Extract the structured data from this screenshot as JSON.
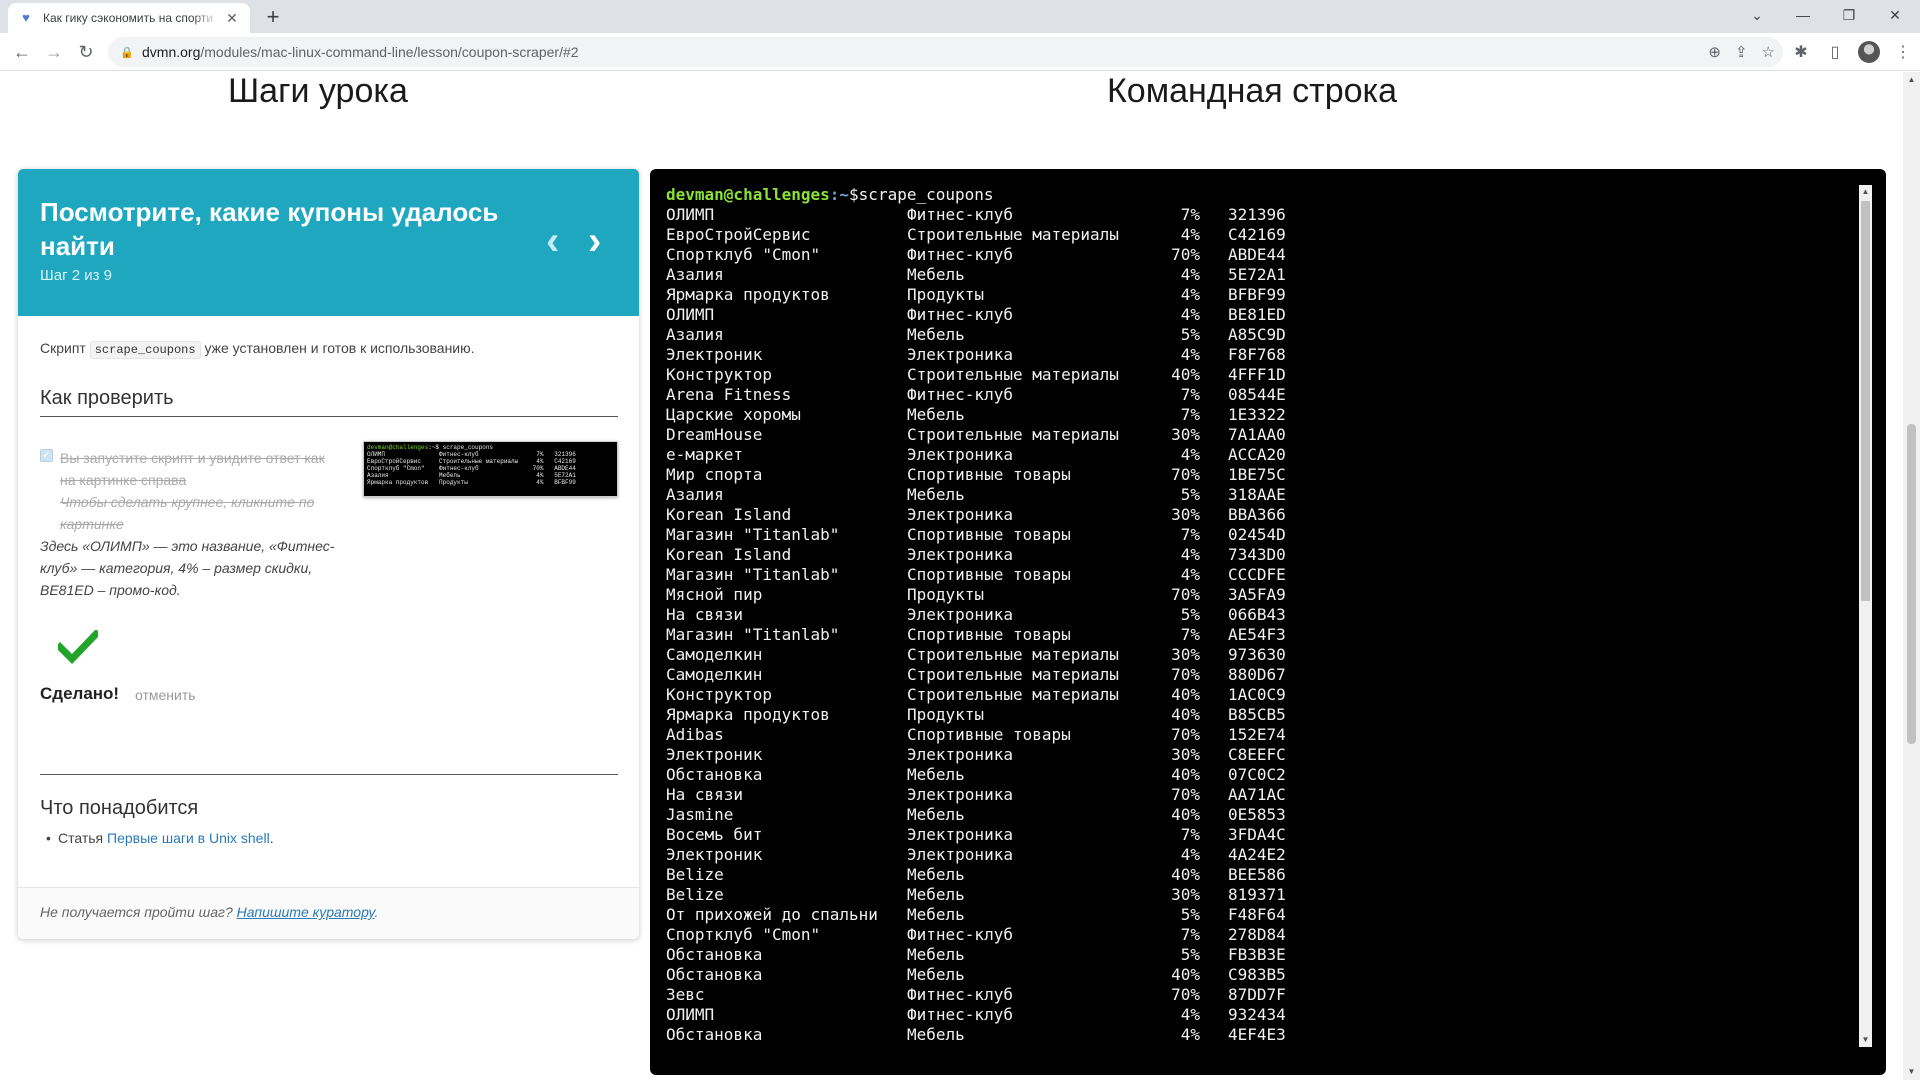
{
  "browser": {
    "tab_title": "Как гику сэкономить на спорти",
    "url_host": "dvmn.org",
    "url_path": "/modules/mac-linux-command-line/lesson/coupon-scraper/#2"
  },
  "headings": {
    "steps": "Шаги урока",
    "command_line": "Командная строка"
  },
  "step": {
    "title": "Посмотрите, какие купоны удалось найти",
    "subtitle": "Шаг 2 из 9",
    "intro_before": "Скрипт",
    "intro_code": "scrape_coupons",
    "intro_after": "уже установлен и готов к использованию.",
    "check_heading": "Как проверить",
    "check_text": "Вы запустите скрипт и увидите ответ как на картинке справа",
    "check_hint": "Чтобы сделать крупнее, кликните по картинке",
    "checked": true,
    "note": "Здесь «ОЛИМП» — это название, «Фитнес-клуб» — категория, 4% – размер скидки, BE81ED – промо-код.",
    "done_label": "Сделано!",
    "cancel_label": "отменить",
    "need_heading": "Что понадобится",
    "need_prefix": "Статья",
    "need_link": "Первые шаги в Unix shell",
    "need_suffix": ".",
    "footer_text": "Не получается пройти шаг?",
    "footer_link": "Напишите куратору",
    "footer_suffix": "."
  },
  "thumbnail": {
    "prompt_user": "devman@challenges",
    "prompt_rest": ":~$ scrape_coupons",
    "lines": [
      "ОЛИМП               Фитнес-клуб                7%   321396",
      "ЕвроСтройСервис     Строительные материалы     4%   C42169",
      "Спортклуб \"Cmon\"    Фитнес-клуб               70%   ABDE44",
      "Азалия              Мебель                     4%   5E72A1",
      "Ярмарка продуктов   Продукты                   4%   BFBF99"
    ]
  },
  "terminal": {
    "prompt_user": "devman@challenges",
    "prompt_path": ":~",
    "prompt_symbol": "$",
    "command": "scrape_coupons",
    "rows": [
      [
        "ОЛИМП",
        "Фитнес-клуб",
        "7%",
        "321396"
      ],
      [
        "ЕвроСтройСервис",
        "Строительные материалы",
        "4%",
        "C42169"
      ],
      [
        "Спортклуб \"Cmon\"",
        "Фитнес-клуб",
        "70%",
        "ABDE44"
      ],
      [
        "Азалия",
        "Мебель",
        "4%",
        "5E72A1"
      ],
      [
        "Ярмарка продуктов",
        "Продукты",
        "4%",
        "BFBF99"
      ],
      [
        "ОЛИМП",
        "Фитнес-клуб",
        "4%",
        "BE81ED"
      ],
      [
        "Азалия",
        "Мебель",
        "5%",
        "A85C9D"
      ],
      [
        "Электроник",
        "Электроника",
        "4%",
        "F8F768"
      ],
      [
        "Конструктор",
        "Строительные материалы",
        "40%",
        "4FFF1D"
      ],
      [
        "Arena Fitness",
        "Фитнес-клуб",
        "7%",
        "08544E"
      ],
      [
        "Царские хоромы",
        "Мебель",
        "7%",
        "1E3322"
      ],
      [
        "DreamHouse",
        "Строительные материалы",
        "30%",
        "7A1AA0"
      ],
      [
        "е-маркет",
        "Электроника",
        "4%",
        "ACCA20"
      ],
      [
        "Мир спорта",
        "Спортивные товары",
        "70%",
        "1BE75C"
      ],
      [
        "Азалия",
        "Мебель",
        "5%",
        "318AAE"
      ],
      [
        "Korean Island",
        "Электроника",
        "30%",
        "BBA366"
      ],
      [
        "Магазин \"Titanlab\"",
        "Спортивные товары",
        "7%",
        "02454D"
      ],
      [
        "Korean Island",
        "Электроника",
        "4%",
        "7343D0"
      ],
      [
        "Магазин \"Titanlab\"",
        "Спортивные товары",
        "4%",
        "CCCDFE"
      ],
      [
        "Мясной пир",
        "Продукты",
        "70%",
        "3A5FA9"
      ],
      [
        "На связи",
        "Электроника",
        "5%",
        "066B43"
      ],
      [
        "Магазин \"Titanlab\"",
        "Спортивные товары",
        "7%",
        "AE54F3"
      ],
      [
        "Самоделкин",
        "Строительные материалы",
        "30%",
        "973630"
      ],
      [
        "Самоделкин",
        "Строительные материалы",
        "70%",
        "880D67"
      ],
      [
        "Конструктор",
        "Строительные материалы",
        "40%",
        "1AC0C9"
      ],
      [
        "Ярмарка продуктов",
        "Продукты",
        "40%",
        "B85CB5"
      ],
      [
        "Adibas",
        "Спортивные товары",
        "70%",
        "152E74"
      ],
      [
        "Электроник",
        "Электроника",
        "30%",
        "C8EEFC"
      ],
      [
        "Обстановка",
        "Мебель",
        "40%",
        "07C0C2"
      ],
      [
        "На связи",
        "Электроника",
        "70%",
        "AA71AC"
      ],
      [
        "Jasmine",
        "Мебель",
        "40%",
        "0E5853"
      ],
      [
        "Восемь бит",
        "Электроника",
        "7%",
        "3FDA4C"
      ],
      [
        "Электроник",
        "Электроника",
        "4%",
        "4A24E2"
      ],
      [
        "Belize",
        "Мебель",
        "40%",
        "BEE586"
      ],
      [
        "Belize",
        "Мебель",
        "30%",
        "819371"
      ],
      [
        "От прихожей до спальни",
        "Мебель",
        "5%",
        "F48F64"
      ],
      [
        "Спортклуб \"Cmon\"",
        "Фитнес-клуб",
        "7%",
        "278D84"
      ],
      [
        "Обстановка",
        "Мебель",
        "5%",
        "FB3B3E"
      ],
      [
        "Обстановка",
        "Мебель",
        "40%",
        "C983B5"
      ],
      [
        "Зевс",
        "Фитнес-клуб",
        "70%",
        "87DD7F"
      ],
      [
        "ОЛИМП",
        "Фитнес-клуб",
        "4%",
        "932434"
      ],
      [
        "Обстановка",
        "Мебель",
        "4%",
        "4EF4E3"
      ]
    ]
  },
  "colors": {
    "card_header": "#1ea7bf",
    "terminal_bg": "#000000",
    "prompt_user": "#8ae234",
    "prompt_path": "#729fcf",
    "done_check": "#22a52a",
    "link": "#2a7ab8"
  },
  "icons": {
    "favicon": "devman-heart-icon",
    "prev": "chevron-left-icon",
    "next": "chevron-right-icon",
    "done": "checkmark-icon"
  }
}
